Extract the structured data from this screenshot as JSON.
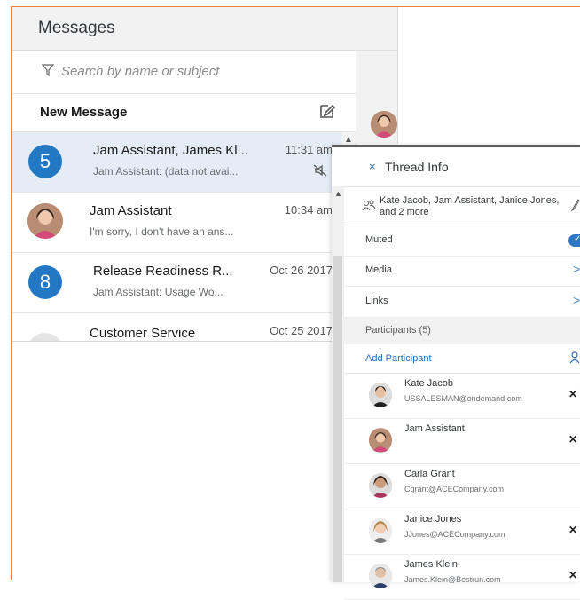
{
  "messages": {
    "title": "Messages",
    "search_placeholder": "Search by name or subject",
    "new_message_label": "New Message",
    "items": [
      {
        "badge": "5",
        "name": "Jam Assistant, James Kl...",
        "preview": "Jam Assistant: (data not avai...",
        "time": "11:31 am",
        "muted": true
      },
      {
        "name": "Jam Assistant",
        "preview": "I'm sorry, I don't have an ans...",
        "time": "10:34 am"
      },
      {
        "badge": "8",
        "name": "Release Readiness R...",
        "preview": "Jam Assistant: Usage Wo...",
        "time": "Oct 26 2017"
      },
      {
        "name": "Customer Service",
        "time": "Oct 25 2017"
      }
    ]
  },
  "thread": {
    "close_label": "×",
    "title": "Thread Info",
    "members": "Kate Jacob, Jam Assistant, Janice Jones, and 2 more",
    "muted_label": "Muted",
    "muted_on": true,
    "media_label": "Media",
    "links_label": "Links",
    "participants_label": "Participants (5)",
    "add_participant_label": "Add Participant",
    "participants": [
      {
        "name": "Kate Jacob",
        "email": "USSALESMAN@ondemand.com",
        "removable": true
      },
      {
        "name": "Jam Assistant",
        "email": "",
        "removable": true
      },
      {
        "name": "Carla Grant",
        "email": "Cgrant@ACECompany.com",
        "removable": false
      },
      {
        "name": "Janice Jones",
        "email": "JJones@ACECompany.com",
        "removable": true
      },
      {
        "name": "James Klein",
        "email": "James.Klein@Bestrun.com",
        "removable": true
      }
    ]
  },
  "colors": {
    "accent": "#2378c4",
    "frame": "#e8843c",
    "link": "#2c6ab6"
  }
}
